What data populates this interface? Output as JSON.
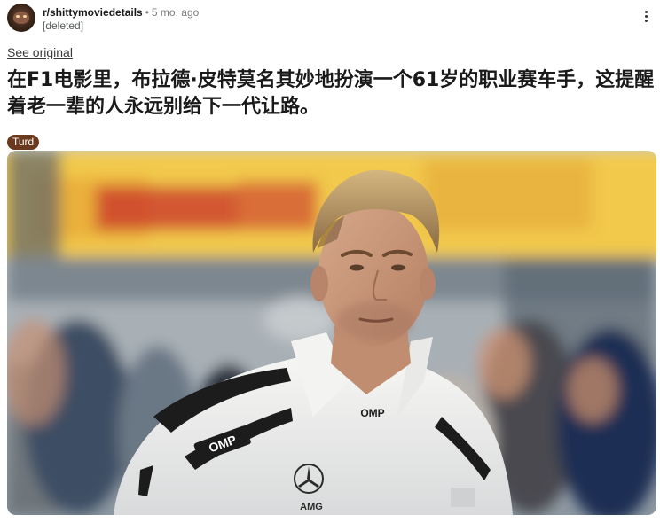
{
  "post": {
    "subreddit": "r/shittymoviedetails",
    "separator": "•",
    "time_ago": "5 mo. ago",
    "author": "[deleted]",
    "see_original": "See original",
    "title": "在F1电影里，布拉德·皮特莫名其妙地扮演一个61岁的职业赛车手，这提醒着老一辈的人永远别给下一代让路。",
    "flair": "Turd",
    "image": {
      "badge_text_1": "OMP",
      "badge_text_2": "OMP",
      "badge_text_3": "AMG"
    }
  },
  "icons": {
    "avatar": "subreddit-avatar",
    "more": "more-options-icon"
  },
  "colors": {
    "flair_bg": "#6b3a1e",
    "banner_yellow": "#f2c94c",
    "banner_red": "#c8322b"
  }
}
